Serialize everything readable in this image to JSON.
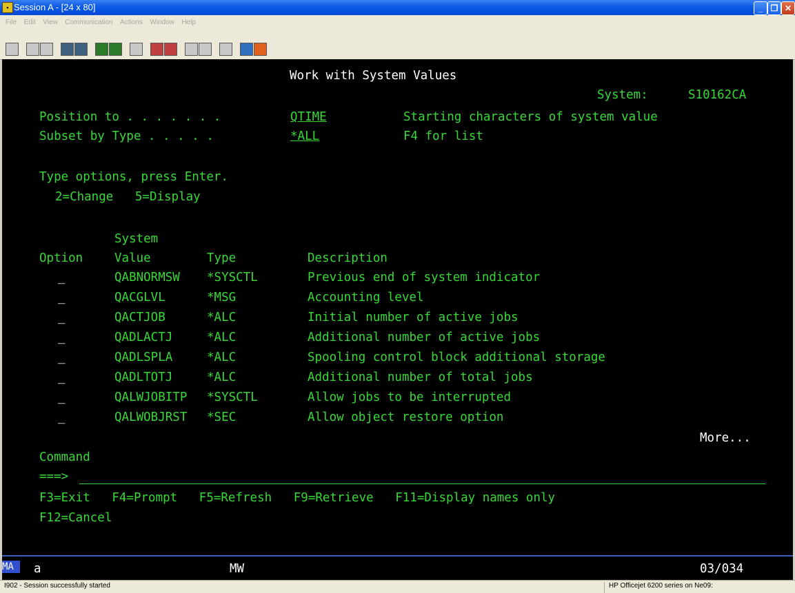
{
  "window": {
    "title": "Session A - [24 x 80]"
  },
  "menu": [
    "File",
    "Edit",
    "View",
    "Communication",
    "Actions",
    "Window",
    "Help"
  ],
  "screen": {
    "title": "Work with System Values",
    "system_label": "System:",
    "system_name": "S10162CA",
    "position_label": "Position to . . . . . . .",
    "position_value": "QTIME",
    "position_help": "Starting characters of system value",
    "subset_label": "Subset by Type . . . . .",
    "subset_value": "*ALL",
    "subset_help": "F4 for list",
    "instructions": "Type options, press Enter.",
    "options_legend": "2=Change   5=Display",
    "col_header_system": "System",
    "col_option": "Option",
    "col_value": "Value",
    "col_type": "Type",
    "col_desc": "Description",
    "rows": [
      {
        "option": "_",
        "value": "QABNORMSW",
        "type": "*SYSCTL",
        "desc": "Previous end of system indicator"
      },
      {
        "option": "_",
        "value": "QACGLVL",
        "type": "*MSG",
        "desc": "Accounting level"
      },
      {
        "option": "_",
        "value": "QACTJOB",
        "type": "*ALC",
        "desc": "Initial number of active jobs"
      },
      {
        "option": "_",
        "value": "QADLACTJ",
        "type": "*ALC",
        "desc": "Additional number of active jobs"
      },
      {
        "option": "_",
        "value": "QADLSPLA",
        "type": "*ALC",
        "desc": "Spooling control block additional storage"
      },
      {
        "option": "_",
        "value": "QADLTOTJ",
        "type": "*ALC",
        "desc": "Additional number of total jobs"
      },
      {
        "option": "_",
        "value": "QALWJOBITP",
        "type": "*SYSCTL",
        "desc": "Allow jobs to be interrupted"
      },
      {
        "option": "_",
        "value": "QALWOBJRST",
        "type": "*SEC",
        "desc": "Allow object restore option"
      }
    ],
    "more": "More...",
    "command_label": "Command",
    "command_prompt": "===>",
    "fkeys_line1": "F3=Exit   F4=Prompt   F5=Refresh   F9=Retrieve   F11=Display names only",
    "fkeys_line2": "F12=Cancel"
  },
  "oia": {
    "ma": "MA",
    "a": "a",
    "mw": "MW",
    "cursor": "03/034"
  },
  "status": {
    "message": "I902 - Session successfully started",
    "printer": "HP Officejet 6200 series on Ne09:"
  },
  "colors": {
    "terminal_green": "#38d838",
    "terminal_bg": "#000000"
  }
}
